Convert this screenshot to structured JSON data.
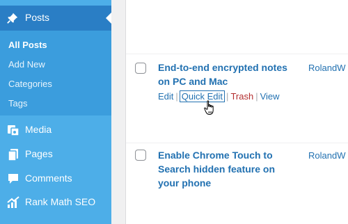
{
  "sidebar": {
    "current": {
      "label": "Posts",
      "icon": "pin-icon"
    },
    "submenu": [
      {
        "label": "All Posts",
        "active": true
      },
      {
        "label": "Add New",
        "active": false
      },
      {
        "label": "Categories",
        "active": false
      },
      {
        "label": "Tags",
        "active": false
      }
    ],
    "items": [
      {
        "label": "Media",
        "icon": "media-icon"
      },
      {
        "label": "Pages",
        "icon": "pages-icon"
      },
      {
        "label": "Comments",
        "icon": "comments-icon"
      },
      {
        "label": "Rank Math SEO",
        "icon": "rank-math-icon"
      }
    ]
  },
  "posts": [
    {
      "title_line1": "End-to-end encrypted notes",
      "title_line2": "on PC and Mac",
      "author": "RolandW",
      "actions": {
        "edit": "Edit",
        "quick_edit": "Quick Edit",
        "trash": "Trash",
        "view": "View",
        "separator": "|"
      }
    },
    {
      "title_line1": "Enable Chrome Touch to",
      "title_line2": "Search hidden feature on",
      "title_line3": "your phone",
      "author": "RolandW"
    }
  ],
  "colors": {
    "sidebar": "#4daee8",
    "sidebar_current": "#2a7ec5",
    "submenu": "#3b9ddd",
    "link": "#2271b1",
    "trash": "#b32d2e"
  }
}
